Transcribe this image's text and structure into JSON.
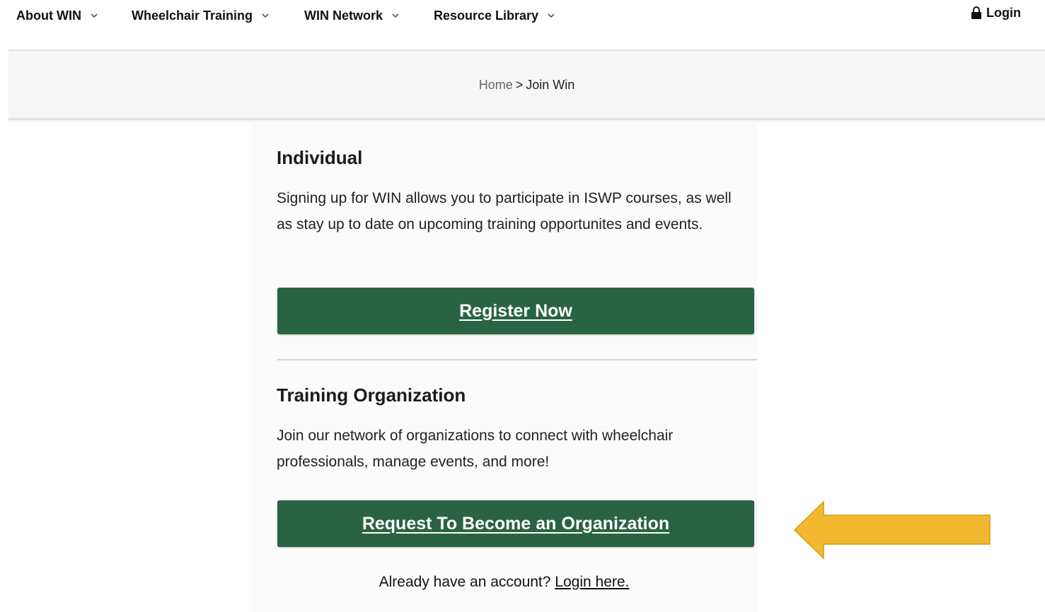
{
  "nav": {
    "items": [
      {
        "label": "About WIN"
      },
      {
        "label": "Wheelchair Training"
      },
      {
        "label": "WIN Network"
      },
      {
        "label": "Resource Library"
      }
    ],
    "login_label": "Login"
  },
  "breadcrumb": {
    "home": "Home",
    "separator": ">",
    "current": "Join Win"
  },
  "individual": {
    "heading": "Individual",
    "text": "Signing up for WIN allows you to participate in ISWP courses, as well as stay up to date on upcoming training opportunites and events.",
    "button_label": "Register Now"
  },
  "organization": {
    "heading": "Training Organization",
    "text": "Join our network of organizations to connect with wheelchair professionals, manage events, and more!",
    "button_label": "Request To Become an Organization"
  },
  "footer": {
    "question": "Already have an account?",
    "login_link": "Login here."
  },
  "colors": {
    "button_green": "#2a6344",
    "arrow_yellow": "#f2b830"
  },
  "icons": [
    "chevron-down-icon",
    "lock-icon",
    "left-arrow-annotation"
  ]
}
